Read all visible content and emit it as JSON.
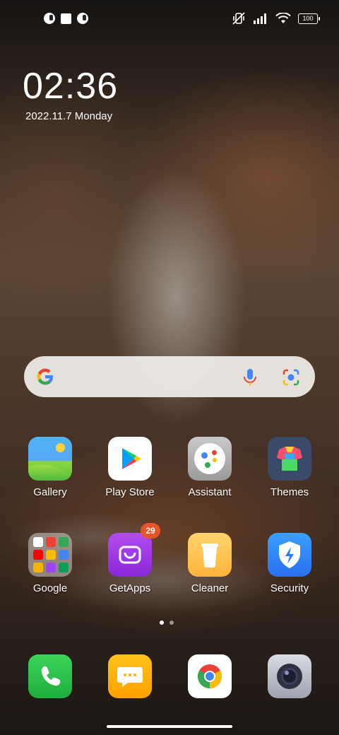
{
  "status_bar": {
    "left_icons": [
      "notification-app-icon",
      "notification-square-icon",
      "notification-app-icon"
    ],
    "right_icons": [
      "vibrate-off-icon",
      "signal-icon",
      "wifi-icon"
    ],
    "battery": "100"
  },
  "lock": {
    "time": "02:36",
    "date": "2022.11.7 Monday"
  },
  "search": {
    "icons": [
      "google-g-icon",
      "mic-icon",
      "lens-icon"
    ]
  },
  "apps": {
    "gallery": "Gallery",
    "play_store": "Play Store",
    "assistant": "Assistant",
    "themes": "Themes",
    "google": "Google",
    "getapps": "GetApps",
    "getapps_badge": "29",
    "cleaner": "Cleaner",
    "security": "Security"
  },
  "dock": [
    "phone-icon",
    "messages-icon",
    "chrome-icon",
    "camera-icon"
  ],
  "page_indicator": {
    "pages": 2,
    "active": 1
  },
  "colors": {
    "badge": "#e8542a",
    "search_bg": "#eeece9"
  }
}
